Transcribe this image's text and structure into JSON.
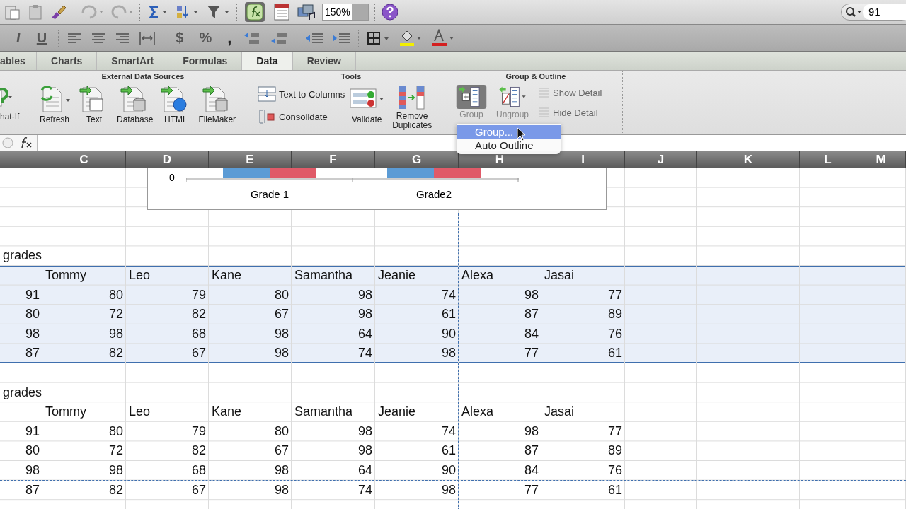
{
  "toolbar": {
    "zoom": "150%",
    "search": "91",
    "format": {
      "italic": "I",
      "underline": "U",
      "currency": "$",
      "percent": "%",
      "comma": ","
    }
  },
  "tabs": [
    {
      "label": "ables",
      "selected": false
    },
    {
      "label": "Charts",
      "selected": false
    },
    {
      "label": "SmartArt",
      "selected": false
    },
    {
      "label": "Formulas",
      "selected": false
    },
    {
      "label": "Data",
      "selected": true
    },
    {
      "label": "Review",
      "selected": false
    }
  ],
  "ribbon": {
    "what_if": "hat-If",
    "external": {
      "title": "External Data Sources",
      "buttons": [
        "Refresh",
        "Text",
        "Database",
        "HTML",
        "FileMaker"
      ]
    },
    "tools": {
      "title": "Tools",
      "text_to_columns": "Text to Columns",
      "consolidate": "Consolidate",
      "validate": "Validate",
      "remove_duplicates": "Remove Duplicates"
    },
    "outline": {
      "title": "Group & Outline",
      "group": "Group",
      "ungroup": "Ungroup",
      "show_detail": "Show Detail",
      "hide_detail": "Hide Detail"
    }
  },
  "menu": [
    {
      "label": "Group...",
      "selected": true
    },
    {
      "label": "Auto Outline",
      "selected": false
    }
  ],
  "columns": [
    "C",
    "D",
    "E",
    "F",
    "G",
    "H",
    "I",
    "J",
    "K",
    "L",
    "M"
  ],
  "chart": {
    "y_tick": "0",
    "categories": [
      "Grade 1",
      "Grade2"
    ]
  },
  "blocks": [
    {
      "title": "grades",
      "selected": true,
      "header": [
        "Tommy",
        "Leo",
        "Kane",
        "Samantha",
        "Jeanie",
        "Alexa",
        "Jasai"
      ],
      "rows": [
        [
          "91",
          "80",
          "79",
          "80",
          "98",
          "74",
          "98",
          "77"
        ],
        [
          "80",
          "72",
          "82",
          "67",
          "98",
          "61",
          "87",
          "89"
        ],
        [
          "98",
          "98",
          "68",
          "98",
          "64",
          "90",
          "84",
          "76"
        ],
        [
          "87",
          "82",
          "67",
          "98",
          "74",
          "98",
          "77",
          "61"
        ]
      ]
    },
    {
      "title": "grades",
      "selected": false,
      "header": [
        "Tommy",
        "Leo",
        "Kane",
        "Samantha",
        "Jeanie",
        "Alexa",
        "Jasai"
      ],
      "rows": [
        [
          "91",
          "80",
          "79",
          "80",
          "98",
          "74",
          "98",
          "77"
        ],
        [
          "80",
          "72",
          "82",
          "67",
          "98",
          "61",
          "87",
          "89"
        ],
        [
          "98",
          "98",
          "68",
          "98",
          "64",
          "90",
          "84",
          "76"
        ],
        [
          "87",
          "82",
          "67",
          "98",
          "74",
          "98",
          "77",
          "61"
        ]
      ]
    }
  ]
}
